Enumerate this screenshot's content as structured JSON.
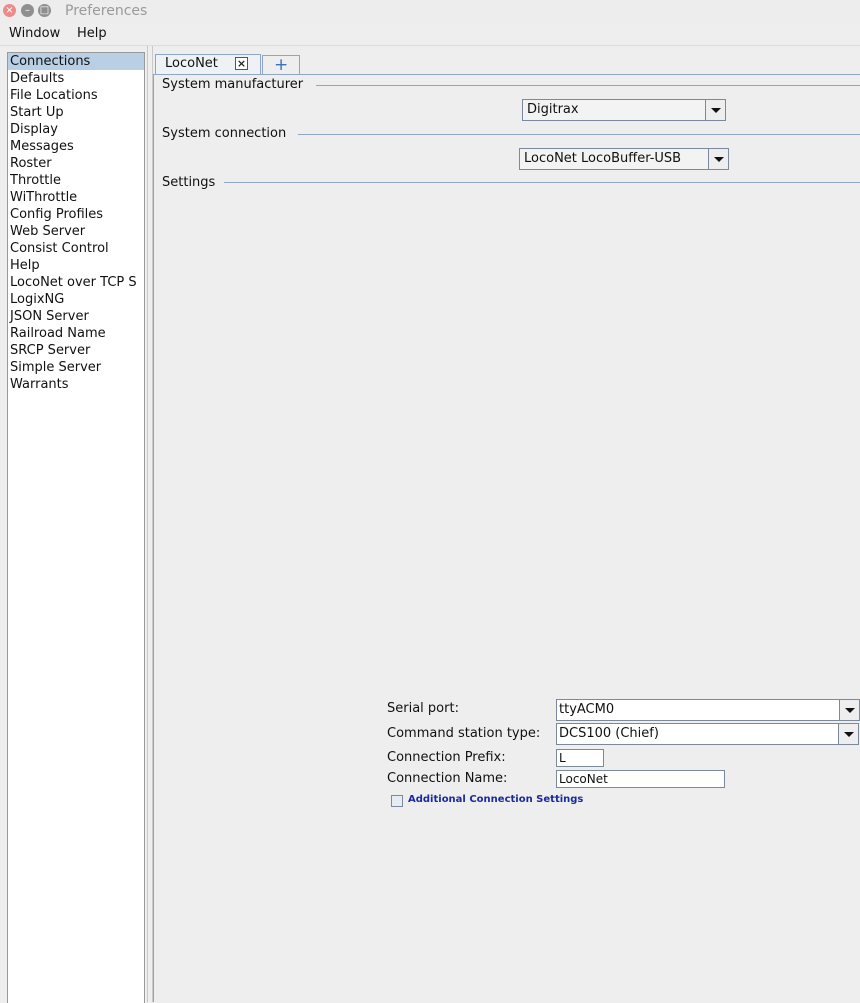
{
  "window": {
    "title": "Preferences",
    "controls": {
      "close_icon": "close-icon",
      "minimize_icon": "minimize-icon",
      "maximize_icon": "maximize-icon"
    }
  },
  "menu": {
    "window": "Window",
    "help": "Help"
  },
  "sidebar": {
    "selected": "Connections",
    "items": [
      "Connections",
      "Defaults",
      "File Locations",
      "Start Up",
      "Display",
      "Messages",
      "Roster",
      "Throttle",
      "WiThrottle",
      "Config Profiles",
      "Web Server",
      "Consist Control",
      "Help",
      "LocoNet over TCP S",
      "LogixNG",
      "JSON Server",
      "Railroad Name",
      "SRCP Server",
      "Simple Server",
      "Warrants"
    ]
  },
  "tabs": {
    "active_label": "LocoNet",
    "close_glyph": "×",
    "add_glyph": "+"
  },
  "sections": {
    "manufacturer_title": "System manufacturer",
    "manufacturer_value": "Digitrax",
    "connection_title": "System connection",
    "connection_value": "LocoNet LocoBuffer-USB",
    "settings_title": "Settings"
  },
  "settings": {
    "serial_port_label": "Serial port:",
    "serial_port_value": "ttyACM0",
    "command_station_label": "Command station type:",
    "command_station_value": "DCS100 (Chief)",
    "prefix_label": "Connection Prefix:",
    "prefix_value": "L",
    "name_label": "Connection Name:",
    "name_value": "LocoNet",
    "additional_label": "Additional Connection Settings",
    "additional_checked": false
  },
  "colors": {
    "selection": "#b8cfe5",
    "rule": "#8ea6c8",
    "link_text": "#1a2a9a",
    "close_button": "#ef8a8a"
  }
}
